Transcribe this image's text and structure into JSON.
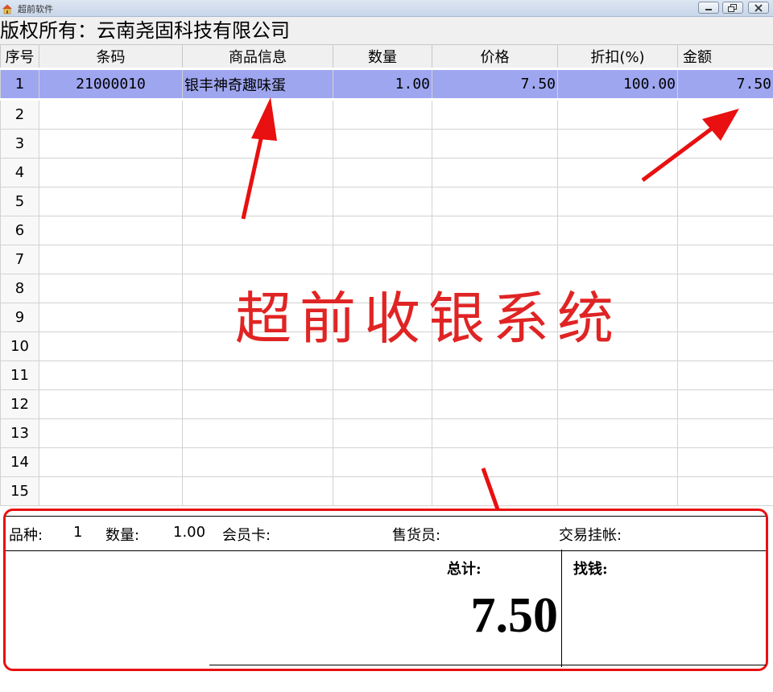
{
  "window": {
    "title": "超前软件",
    "app_icon": "house-icon",
    "buttons": [
      "minimize-icon",
      "restore-icon",
      "close-icon"
    ]
  },
  "copyright": "版权所有：云南尧固科技有限公司",
  "table": {
    "headers": [
      "序号",
      "条码",
      "商品信息",
      "数量",
      "价格",
      "折扣(%)",
      "金额"
    ],
    "rows": [
      {
        "seq": "1",
        "barcode": "21000010",
        "name": "银丰神奇趣味蛋",
        "qty": "1.00",
        "price": "7.50",
        "discount": "100.00",
        "amount": "7.50"
      },
      {
        "seq": "2",
        "barcode": "",
        "name": "",
        "qty": "",
        "price": "",
        "discount": "",
        "amount": ""
      },
      {
        "seq": "3",
        "barcode": "",
        "name": "",
        "qty": "",
        "price": "",
        "discount": "",
        "amount": ""
      },
      {
        "seq": "4",
        "barcode": "",
        "name": "",
        "qty": "",
        "price": "",
        "discount": "",
        "amount": ""
      },
      {
        "seq": "5",
        "barcode": "",
        "name": "",
        "qty": "",
        "price": "",
        "discount": "",
        "amount": ""
      },
      {
        "seq": "6",
        "barcode": "",
        "name": "",
        "qty": "",
        "price": "",
        "discount": "",
        "amount": ""
      },
      {
        "seq": "7",
        "barcode": "",
        "name": "",
        "qty": "",
        "price": "",
        "discount": "",
        "amount": ""
      },
      {
        "seq": "8",
        "barcode": "",
        "name": "",
        "qty": "",
        "price": "",
        "discount": "",
        "amount": ""
      },
      {
        "seq": "9",
        "barcode": "",
        "name": "",
        "qty": "",
        "price": "",
        "discount": "",
        "amount": ""
      },
      {
        "seq": "10",
        "barcode": "",
        "name": "",
        "qty": "",
        "price": "",
        "discount": "",
        "amount": ""
      },
      {
        "seq": "11",
        "barcode": "",
        "name": "",
        "qty": "",
        "price": "",
        "discount": "",
        "amount": ""
      },
      {
        "seq": "12",
        "barcode": "",
        "name": "",
        "qty": "",
        "price": "",
        "discount": "",
        "amount": ""
      },
      {
        "seq": "13",
        "barcode": "",
        "name": "",
        "qty": "",
        "price": "",
        "discount": "",
        "amount": ""
      },
      {
        "seq": "14",
        "barcode": "",
        "name": "",
        "qty": "",
        "price": "",
        "discount": "",
        "amount": ""
      },
      {
        "seq": "15",
        "barcode": "",
        "name": "",
        "qty": "",
        "price": "",
        "discount": "",
        "amount": ""
      }
    ]
  },
  "watermark": "超前收银系统",
  "annotation_color": "#e81010",
  "summary": {
    "variety_label": "品种:",
    "variety_value": "1",
    "qty_label": "数量:",
    "qty_value": "1.00",
    "member_label": "会员卡:",
    "cashier_label": "售货员:",
    "hold_label": "交易挂帐:",
    "total_label": "总计:",
    "total_value": "7.50",
    "change_label": "找钱:"
  }
}
